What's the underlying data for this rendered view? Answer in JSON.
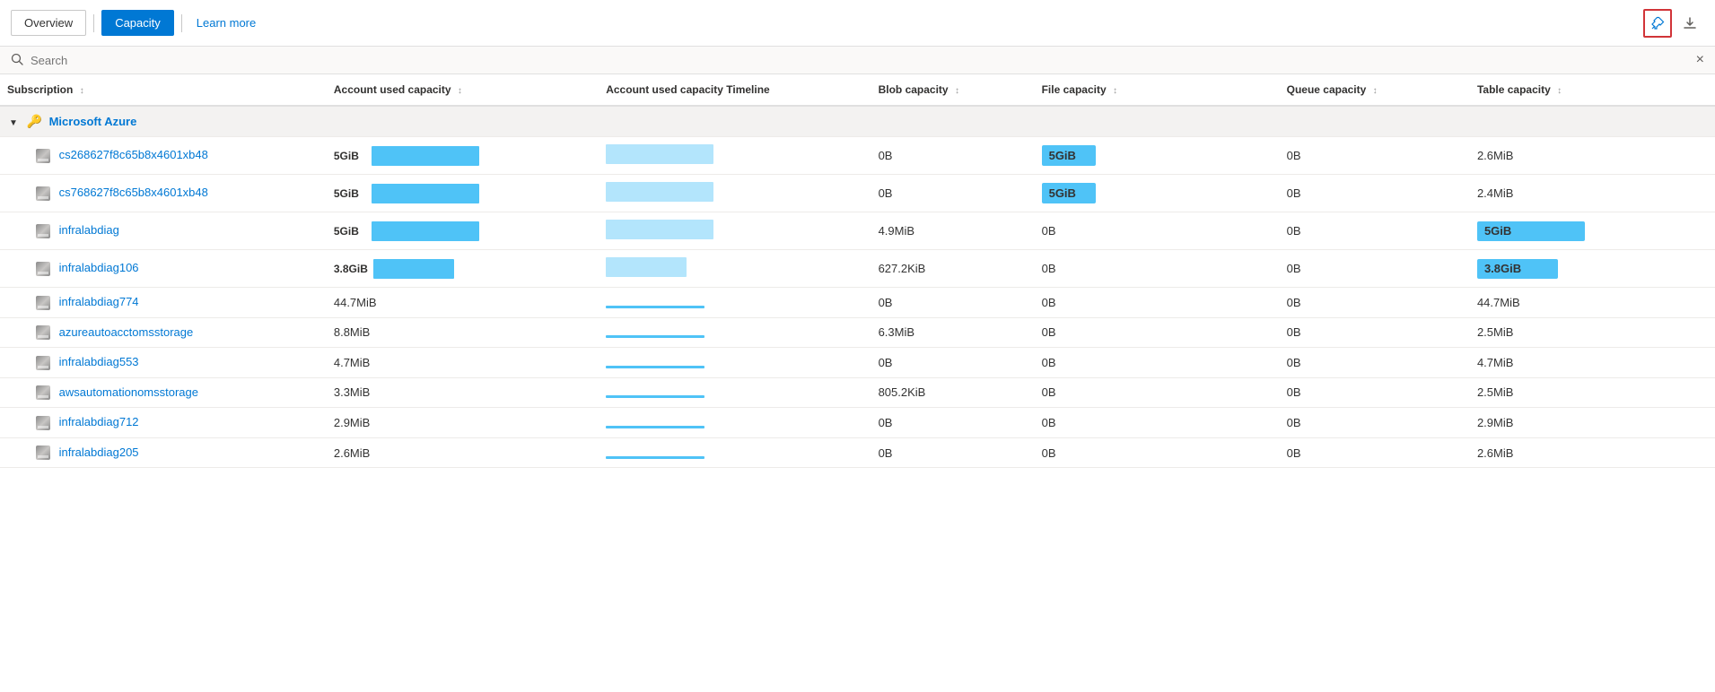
{
  "nav": {
    "overview_label": "Overview",
    "capacity_label": "Capacity",
    "learn_more_label": "Learn more"
  },
  "toolbar": {
    "pin_tooltip": "Pin",
    "download_tooltip": "Download"
  },
  "search": {
    "placeholder": "Search",
    "clear_label": "×"
  },
  "table": {
    "columns": [
      {
        "id": "subscription",
        "label": "Subscription"
      },
      {
        "id": "acct_used",
        "label": "Account used capacity"
      },
      {
        "id": "timeline",
        "label": "Account used capacity Timeline"
      },
      {
        "id": "blob",
        "label": "Blob capacity"
      },
      {
        "id": "file",
        "label": "File capacity"
      },
      {
        "id": "queue",
        "label": "Queue capacity"
      },
      {
        "id": "table",
        "label": "Table capacity"
      }
    ],
    "group": {
      "name": "Microsoft Azure",
      "icon": "key"
    },
    "rows": [
      {
        "name": "cs268627f8c65b8x4601xb48",
        "acct_used_val": "5GiB",
        "acct_used_bar": "large",
        "timeline_bar": "large",
        "blob": "0B",
        "file_val": "5GiB",
        "file_bar": true,
        "queue": "0B",
        "table": "2.6MiB",
        "table_bar": false
      },
      {
        "name": "cs768627f8c65b8x4601xb48",
        "acct_used_val": "5GiB",
        "acct_used_bar": "large",
        "timeline_bar": "large",
        "blob": "0B",
        "file_val": "5GiB",
        "file_bar": true,
        "queue": "0B",
        "table": "2.4MiB",
        "table_bar": false
      },
      {
        "name": "infralabdiag",
        "acct_used_val": "5GiB",
        "acct_used_bar": "large",
        "timeline_bar": "large",
        "blob": "4.9MiB",
        "file_val": "0B",
        "file_bar": false,
        "queue": "0B",
        "table": "5GiB",
        "table_bar": true
      },
      {
        "name": "infralabdiag106",
        "acct_used_val": "3.8GiB",
        "acct_used_bar": "medium",
        "timeline_bar": "medium",
        "blob": "627.2KiB",
        "file_val": "0B",
        "file_bar": false,
        "queue": "0B",
        "table": "3.8GiB",
        "table_bar": true
      },
      {
        "name": "infralabdiag774",
        "acct_used_val": "44.7MiB",
        "acct_used_bar": null,
        "timeline_bar": "line",
        "blob": "0B",
        "file_val": "0B",
        "file_bar": false,
        "queue": "0B",
        "table": "44.7MiB",
        "table_bar": false
      },
      {
        "name": "azureautoacctomsstorage",
        "acct_used_val": "8.8MiB",
        "acct_used_bar": null,
        "timeline_bar": "line",
        "blob": "6.3MiB",
        "file_val": "0B",
        "file_bar": false,
        "queue": "0B",
        "table": "2.5MiB",
        "table_bar": false
      },
      {
        "name": "infralabdiag553",
        "acct_used_val": "4.7MiB",
        "acct_used_bar": null,
        "timeline_bar": "line",
        "blob": "0B",
        "file_val": "0B",
        "file_bar": false,
        "queue": "0B",
        "table": "4.7MiB",
        "table_bar": false
      },
      {
        "name": "awsautomationomsstorage",
        "acct_used_val": "3.3MiB",
        "acct_used_bar": null,
        "timeline_bar": "line",
        "blob": "805.2KiB",
        "file_val": "0B",
        "file_bar": false,
        "queue": "0B",
        "table": "2.5MiB",
        "table_bar": false
      },
      {
        "name": "infralabdiag712",
        "acct_used_val": "2.9MiB",
        "acct_used_bar": null,
        "timeline_bar": "line",
        "blob": "0B",
        "file_val": "0B",
        "file_bar": false,
        "queue": "0B",
        "table": "2.9MiB",
        "table_bar": false
      },
      {
        "name": "infralabdiag205",
        "acct_used_val": "2.6MiB",
        "acct_used_bar": null,
        "timeline_bar": "line",
        "blob": "0B",
        "file_val": "0B",
        "file_bar": false,
        "queue": "0B",
        "table": "2.6MiB",
        "table_bar": false
      }
    ]
  }
}
